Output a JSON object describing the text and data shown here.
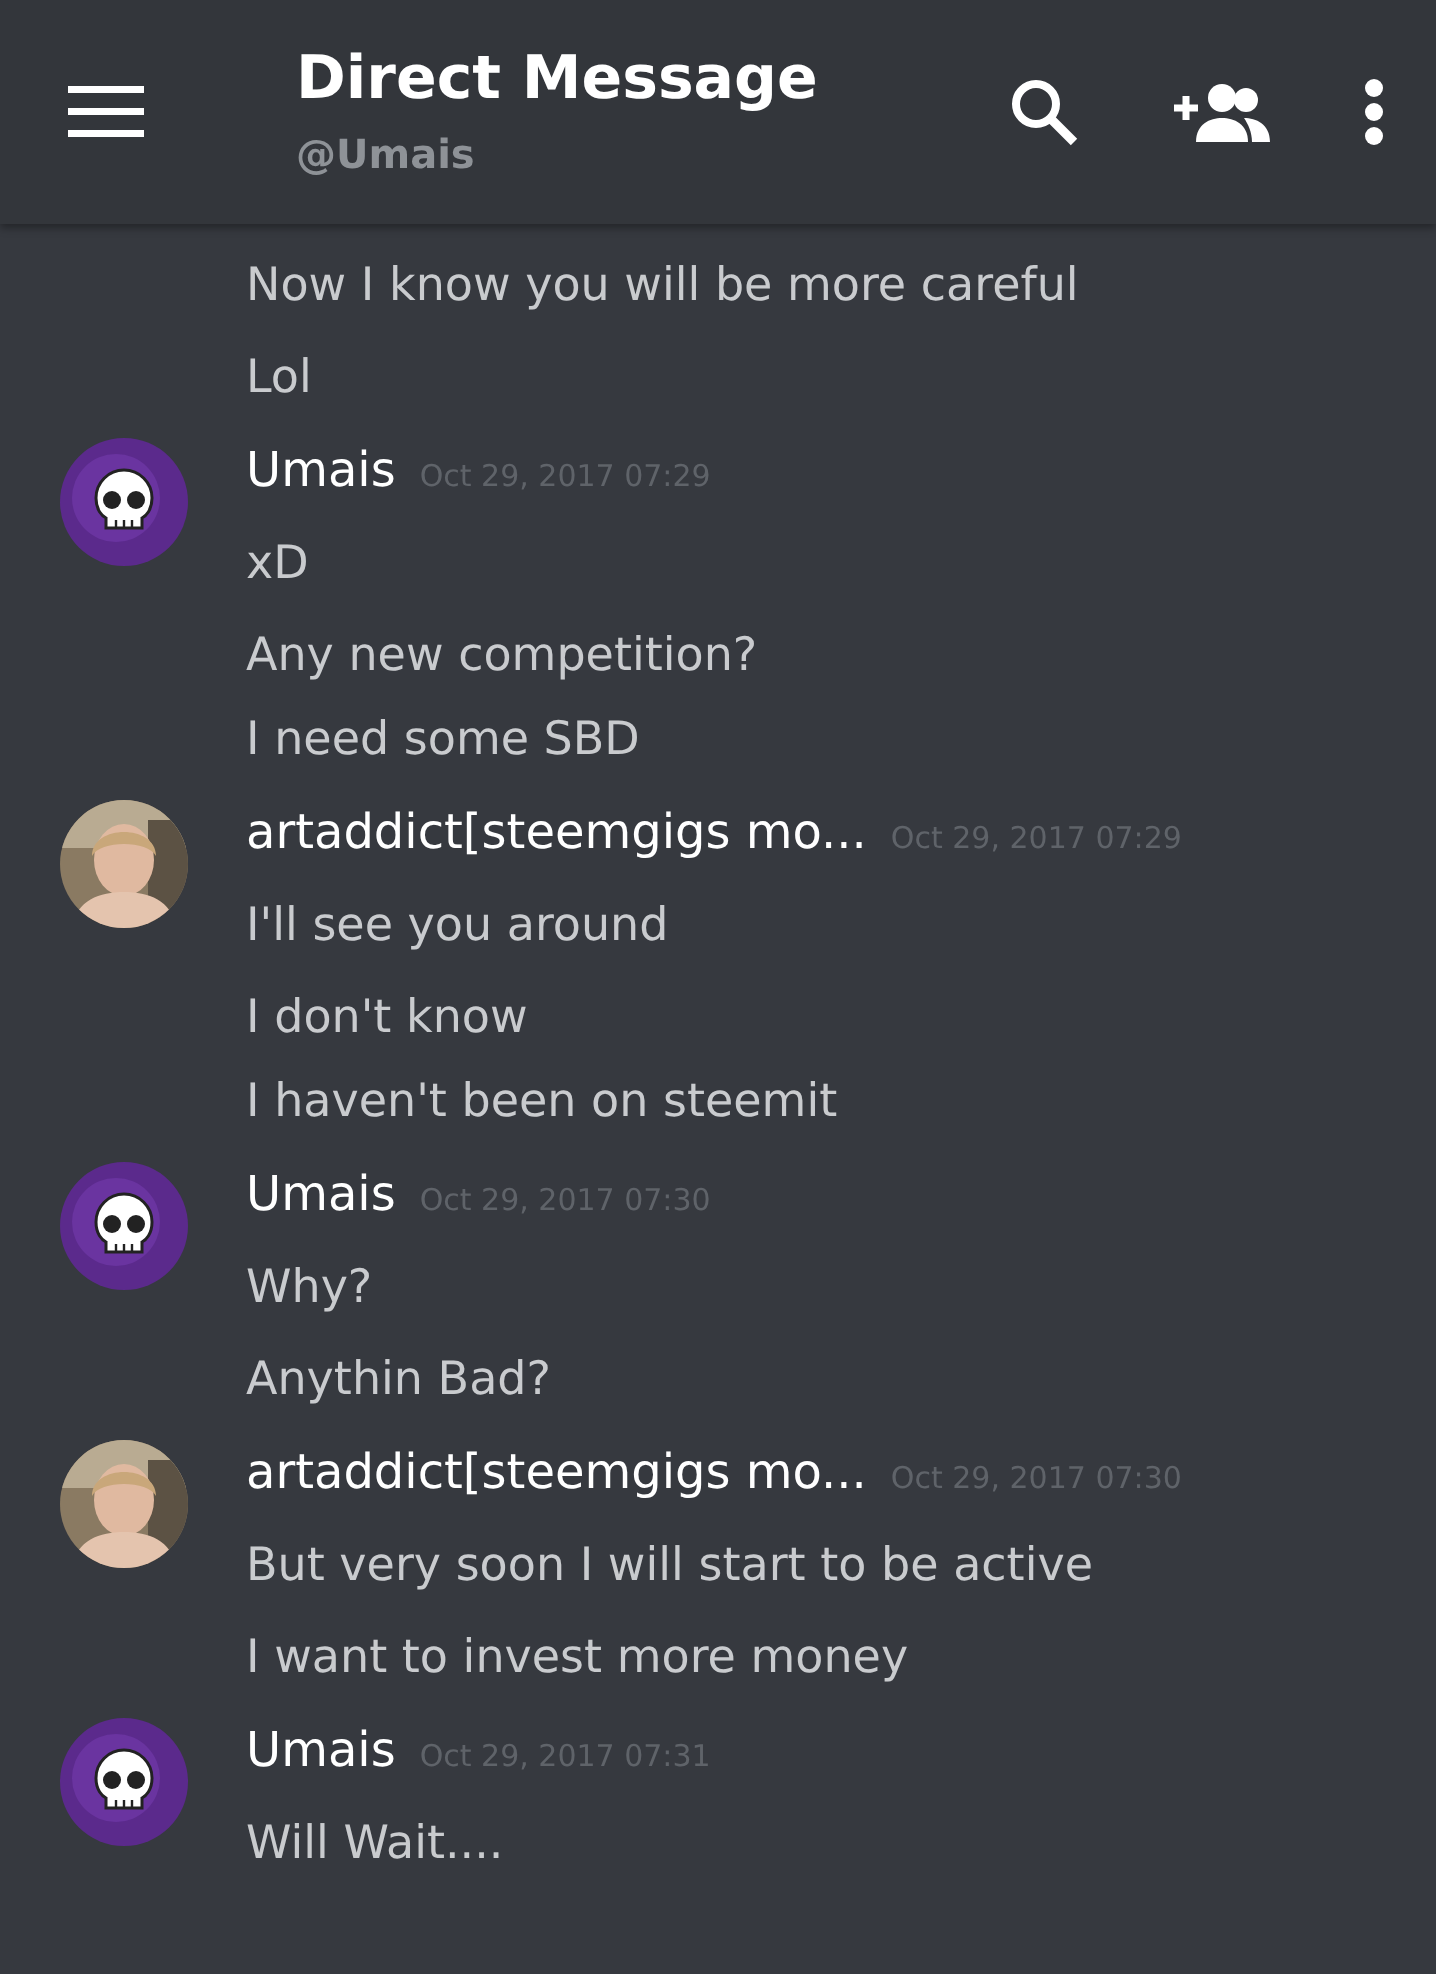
{
  "header": {
    "title": "Direct Message",
    "subtitle": "@Umais"
  },
  "groups": [
    {
      "continued": true,
      "messages": [
        {
          "lines": [
            "Now I know you will be more careful"
          ]
        },
        {
          "lines": [
            "Lol"
          ]
        }
      ]
    },
    {
      "continued": false,
      "author": "Umais",
      "avatar": {
        "kind": "skull"
      },
      "time": "Oct 29, 2017 07:29",
      "messages": [
        {
          "lines": [
            "xD"
          ]
        },
        {
          "lines": [
            "Any new competition?",
            "I need some SBD"
          ]
        }
      ]
    },
    {
      "continued": false,
      "author": "artaddict[steemgigs mo...",
      "time": "Oct 29, 2017 07:29",
      "messages": [
        {
          "lines": [
            "I'll see you around"
          ]
        },
        {
          "lines": [
            "I don't know",
            "I haven't been on steemit"
          ]
        }
      ]
    },
    {
      "continued": false,
      "author": "Umais",
      "avatar": {
        "kind": "skull"
      },
      "time": "Oct 29, 2017 07:30",
      "messages": [
        {
          "lines": [
            "Why?"
          ]
        },
        {
          "lines": [
            "Anythin Bad?"
          ]
        }
      ]
    },
    {
      "continued": false,
      "author": "artaddict[steemgigs mo...",
      "time": "Oct 29, 2017 07:30",
      "messages": [
        {
          "lines": [
            "But very soon I will start to be active"
          ]
        },
        {
          "lines": [
            "I want to invest more money"
          ]
        }
      ]
    },
    {
      "continued": false,
      "author": "Umais",
      "avatar": {
        "kind": "skull"
      },
      "time": "Oct 29, 2017 07:31",
      "messages": [
        {
          "lines": [
            "Will Wait...."
          ]
        }
      ]
    }
  ]
}
